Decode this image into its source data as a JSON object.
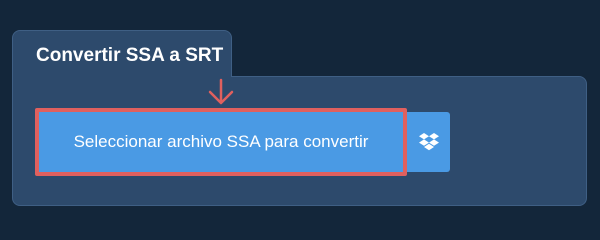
{
  "converter": {
    "title": "Convertir SSA a SRT",
    "select_button_label": "Seleccionar archivo SSA para convertir",
    "dropbox_icon": "dropbox-icon"
  },
  "colors": {
    "background": "#13263a",
    "panel": "#2d4a6c",
    "button": "#4a9ae4",
    "highlight": "#e0605e"
  }
}
